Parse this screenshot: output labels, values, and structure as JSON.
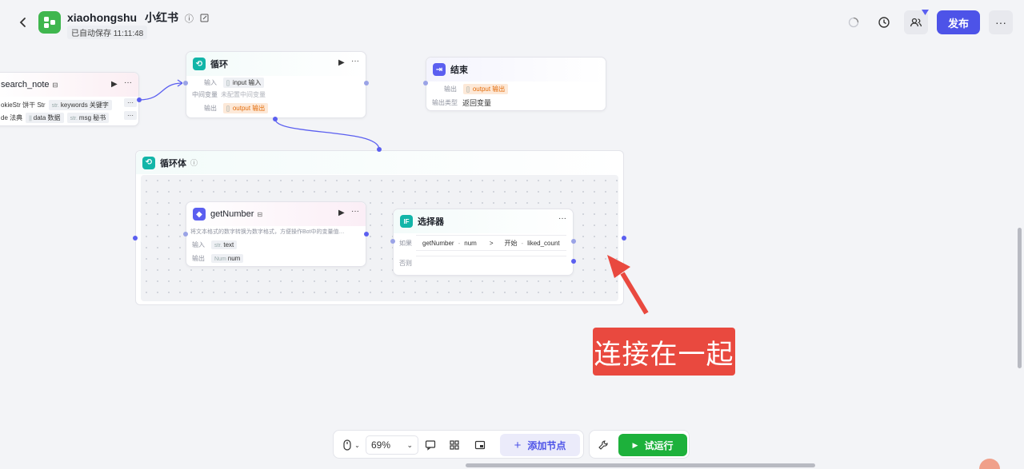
{
  "header": {
    "back_icon": "chevron-left-icon",
    "app_name": "xiaohongshu",
    "app_name_cn": "小红书",
    "info_mark": "ⓘ",
    "edit_icon": "edit-icon",
    "saved_text": "已自动保存 11:11:48",
    "publish_label": "发布",
    "more_label": "···",
    "brand_color": "#4d53e8"
  },
  "nodes": {
    "search_note": {
      "title": "search_note",
      "run_label": "▶",
      "more_label": "···",
      "row1": {
        "a": "okieStr 饼干 Str",
        "b_type": "str.",
        "b": "keywords 关键字"
      },
      "row2": {
        "a": "de 法典",
        "b_type": "||",
        "b": "data 数据",
        "c_type": "str.",
        "c": "msg 秘书"
      },
      "more1": "···",
      "more2": "···"
    },
    "loop": {
      "title": "循环",
      "run_label": "▶",
      "more_label": "···",
      "input_label": "输入",
      "input_value": "input 输入",
      "input_type": "[] ",
      "mid_label": "中间变量",
      "mid_value": "未配置中间变量",
      "output_label": "输出",
      "output_type": "[] ",
      "output_value": "output 输出"
    },
    "end": {
      "title": "结束",
      "output_label": "输出",
      "output_type": "[] ",
      "output_value": "output 输出",
      "type_label": "输出类型",
      "type_value": "返回变量"
    },
    "loop_body": {
      "title": "循环体",
      "info_mark": "ⓘ"
    },
    "get_number": {
      "title": "getNumber",
      "run_label": "▶",
      "more_label": "···",
      "description": "将文本格式的数字转换为数字格式，方便操作Bot中的变量值…",
      "input_label": "输入",
      "input_type": "str.",
      "input_value": "text",
      "output_label": "输出",
      "output_type": "Num",
      "output_value": "num"
    },
    "selector": {
      "title": "选择器",
      "if_icon": "IF",
      "more_label": "···",
      "if_label": "如果",
      "cond_left": "getNumber",
      "cond_sep": "-",
      "cond_var": "num",
      "cond_op": ">",
      "cond_right": "开始",
      "cond_sep2": "-",
      "cond_right_var": "liked_count",
      "else_label": "否则"
    }
  },
  "toolbar": {
    "pointer_icon": "mouse-icon",
    "zoom": "69%",
    "add_node_label": "添加节点",
    "add_icon": "+",
    "run_label": "试运行",
    "run_icon": "▶"
  },
  "annotation": {
    "text": "连接在一起",
    "color": "#e9493f"
  }
}
